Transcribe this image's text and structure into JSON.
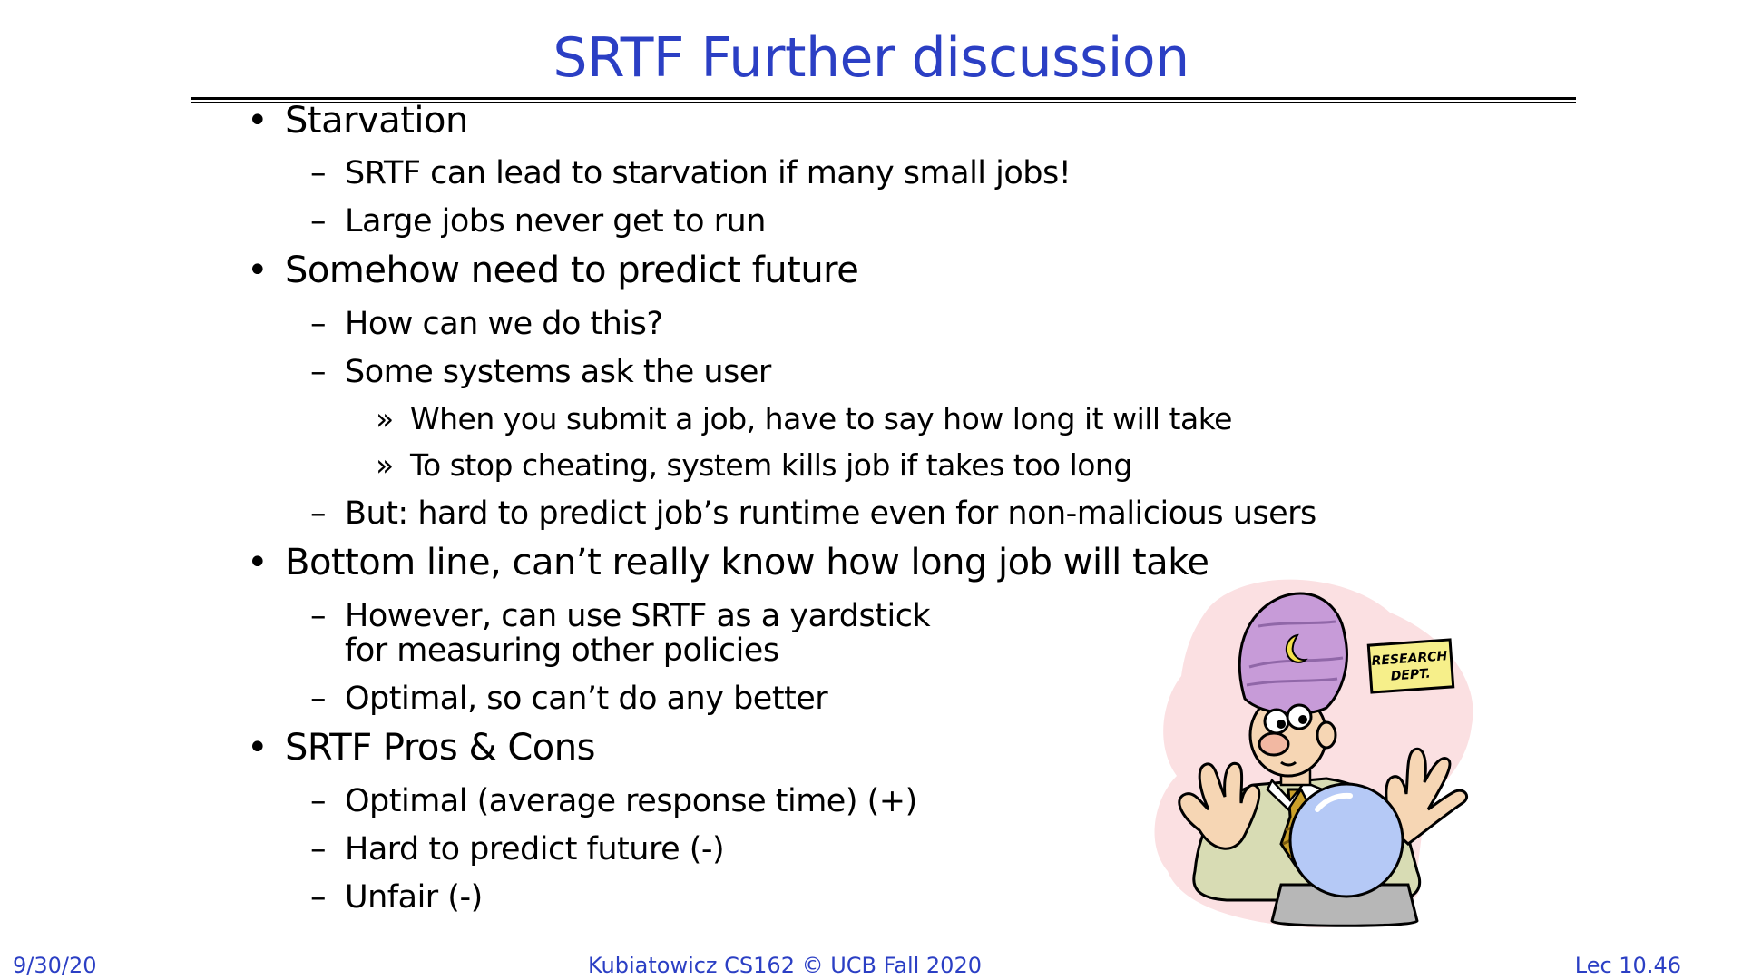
{
  "slide": {
    "title": "SRTF Further discussion"
  },
  "bullets": [
    {
      "marker": "•",
      "text": "Starvation",
      "subs": [
        {
          "marker": "–",
          "text": "SRTF can lead to starvation if many small jobs!"
        },
        {
          "marker": "–",
          "text": "Large jobs never get to run"
        }
      ]
    },
    {
      "marker": "•",
      "text": "Somehow need to predict future",
      "subs": [
        {
          "marker": "–",
          "text": "How can we do this?"
        },
        {
          "marker": "–",
          "text": "Some systems ask the user",
          "subs": [
            {
              "marker": "»",
              "text": "When you submit a job, have to say how long it will take"
            },
            {
              "marker": "»",
              "text": "To stop cheating, system kills job if takes too long"
            }
          ]
        },
        {
          "marker": "–",
          "text": "But: hard to predict job’s runtime even for non-malicious users"
        }
      ]
    },
    {
      "marker": "•",
      "text": "Bottom line, can’t really know how long job will take",
      "subs": [
        {
          "marker": "–",
          "text": "However, can use SRTF as a yardstick",
          "text_line2": "for measuring other policies"
        },
        {
          "marker": "–",
          "text": "Optimal, so can’t do any better"
        }
      ]
    },
    {
      "marker": "•",
      "text": "SRTF Pros & Cons",
      "subs": [
        {
          "marker": "–",
          "text": "Optimal (average response time) (+)"
        },
        {
          "marker": "–",
          "text": "Hard to predict future (-)"
        },
        {
          "marker": "–",
          "text": "Unfair (-)"
        }
      ]
    }
  ],
  "illustration": {
    "sign_line1": "RESEARCH",
    "sign_line2": "DEPT."
  },
  "footer": {
    "date": "9/30/20",
    "course": "Kubiatowicz CS162 © UCB Fall 2020",
    "lecture": "Lec 10.46"
  }
}
